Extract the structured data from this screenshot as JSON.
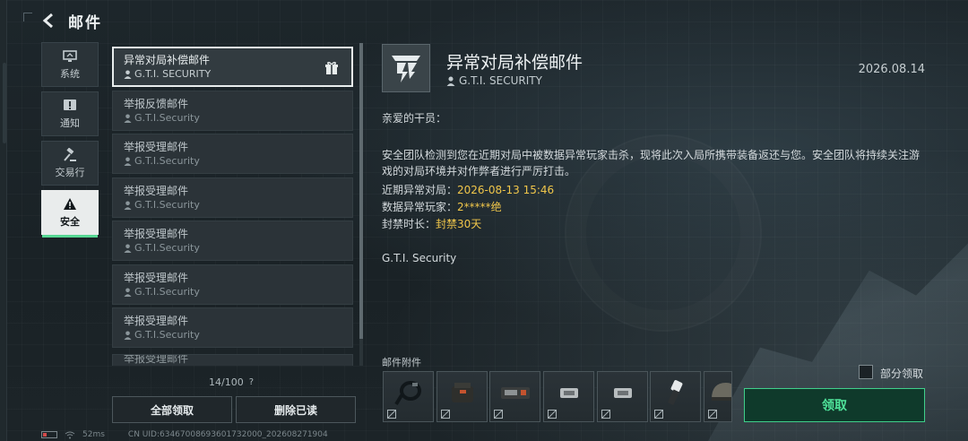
{
  "header": {
    "title": "邮件"
  },
  "categories": [
    {
      "label": "系统",
      "icon": "monitor-icon"
    },
    {
      "label": "通知",
      "icon": "alert-icon"
    },
    {
      "label": "交易行",
      "icon": "gavel-icon"
    },
    {
      "label": "安全",
      "icon": "warning-icon",
      "active": true
    }
  ],
  "mail_list": {
    "items": [
      {
        "subject": "异常对局补偿邮件",
        "sender": "G.T.I. SECURITY",
        "selected": true,
        "has_gift": true
      },
      {
        "subject": "举报反馈邮件",
        "sender": "G.T.I.Security"
      },
      {
        "subject": "举报受理邮件",
        "sender": "G.T.I.Security"
      },
      {
        "subject": "举报受理邮件",
        "sender": "G.T.I.Security"
      },
      {
        "subject": "举报受理邮件",
        "sender": "G.T.I.Security"
      },
      {
        "subject": "举报受理邮件",
        "sender": "G.T.I.Security"
      },
      {
        "subject": "举报受理邮件",
        "sender": "G.T.I.Security"
      },
      {
        "subject": "举报受理邮件",
        "sender": ""
      }
    ],
    "count": "14/100",
    "help": "?",
    "claim_all_label": "全部领取",
    "delete_read_label": "删除已读"
  },
  "detail": {
    "title": "异常对局补偿邮件",
    "sender": "G.T.I. SECURITY",
    "date": "2026.08.14",
    "greeting": "亲爱的干员：",
    "paragraph": "安全团队检测到您在近期对局中被数据异常玩家击杀，现将此次入局所携带装备返还与您。安全团队将持续关注游戏的对局环境并对作弊者进行严厉打击。",
    "fields": [
      {
        "label": "近期异常对局：",
        "value": "2026-08-13 15:46"
      },
      {
        "label": "数据异常玩家：",
        "value": "2*****绝"
      },
      {
        "label": "封禁时长：",
        "value": "封禁30天"
      }
    ],
    "signature": "G.T.I. Security",
    "attachments_label": "邮件附件",
    "attachments": [
      {
        "icon": "cord-item-icon"
      },
      {
        "icon": "pouch-item-icon"
      },
      {
        "icon": "device-item-icon"
      },
      {
        "icon": "ammo-item-icon"
      },
      {
        "icon": "ammo-item-icon"
      },
      {
        "icon": "flashlight-item-icon"
      },
      {
        "icon": "helmet-item-icon"
      }
    ],
    "partial_claim_label": "部分领取",
    "claim_label": "领取"
  },
  "status_bar": {
    "ping": "52ms",
    "uid": "CN UID:63467008693601732000_202608271904"
  },
  "colors": {
    "accent_green": "#3fcf8a",
    "highlight_yellow": "#f0c64a"
  }
}
